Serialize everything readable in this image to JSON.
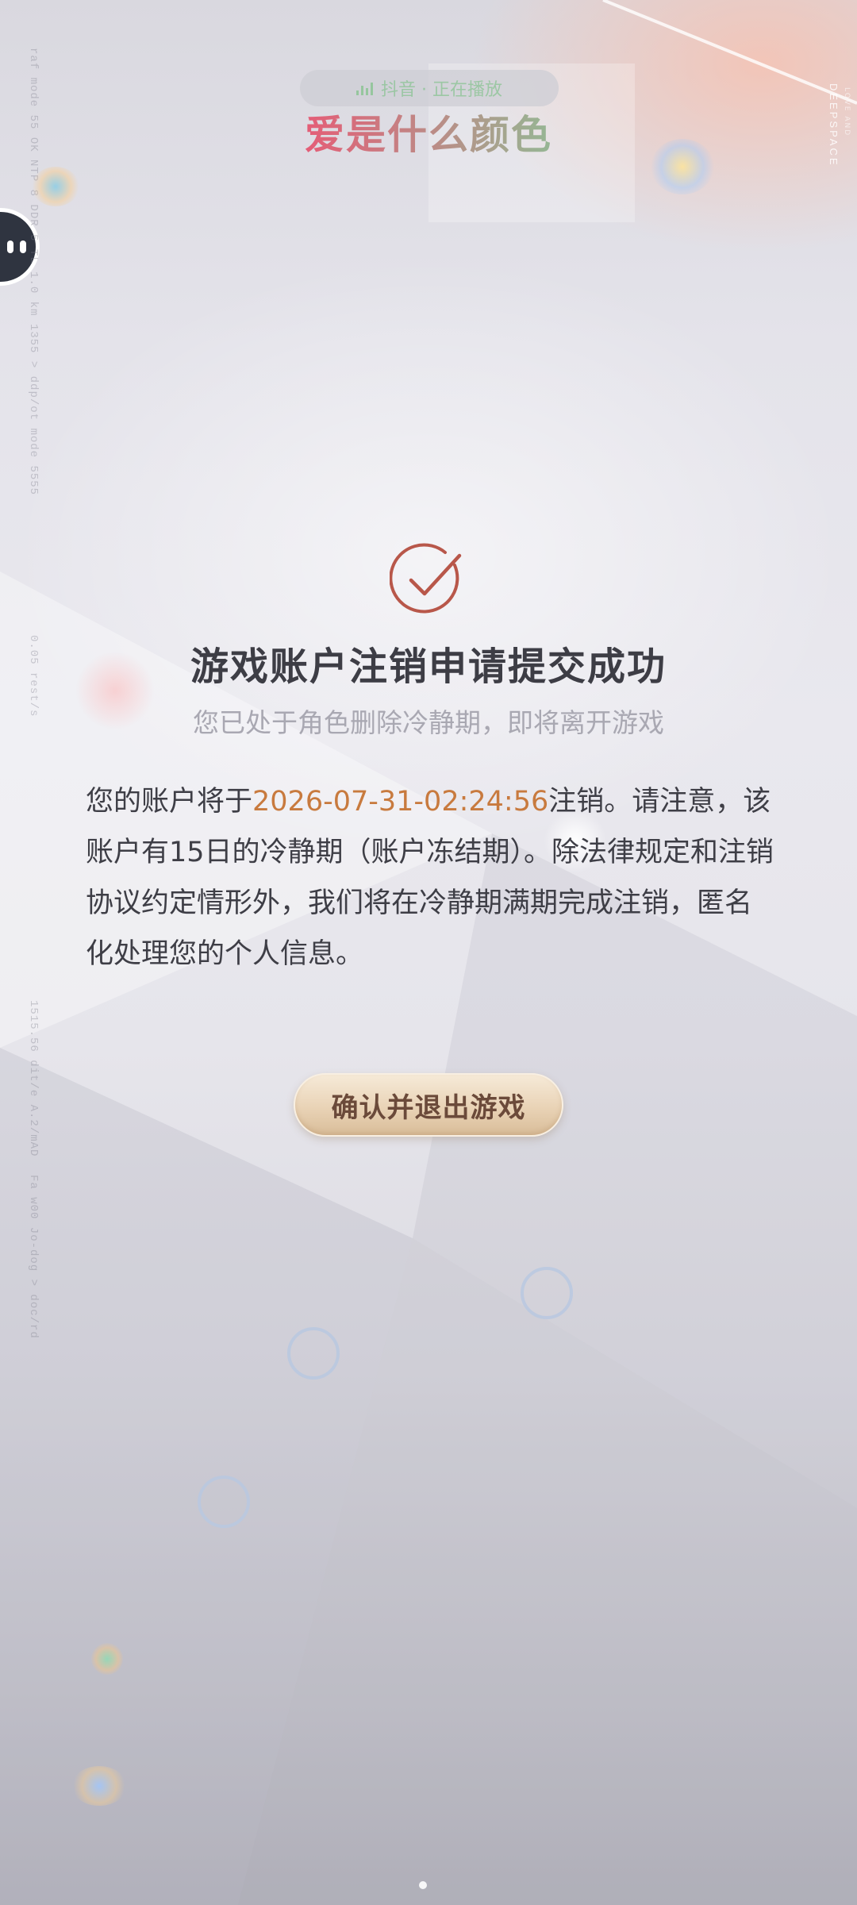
{
  "overlay": {
    "music_status": "抖音 · 正在播放",
    "lyric": "爱是什么颜色"
  },
  "brand": {
    "name": "DEEPSPACE",
    "sub": "LOVE AND"
  },
  "side_texts": [
    "raf mode 55 OK NTP 8 DDR 5 TL 1.0 km 1355 > ddp/ot mode 5555",
    "0.05 rest/s",
    "1515.56 dit/e A.2/mAD",
    "Fa w00 Jo-dog > doc/rd"
  ],
  "result": {
    "title": "游戏账户注销申请提交成功",
    "subtitle": "您已处于角色删除冷静期，即将离开游戏",
    "body_prefix": "您的账户将于",
    "deadline": "2026-07-31-02:24:56",
    "body_suffix": "注销。请注意，该账户有15日的冷静期（账户冻结期）。除法律规定和注销协议约定情形外，我们将在冷静期满期完成注销，匿名化处理您的个人信息。",
    "confirm_label": "确认并退出游戏"
  },
  "colors": {
    "accent": "#c87a3e",
    "check_icon": "#b8574a",
    "title": "#3d3d45",
    "subtitle": "#a9a8b2",
    "button_text": "#6b4a3a"
  },
  "icons": {
    "check": "check-circle-icon",
    "float_ball": "assistant-float-icon"
  }
}
